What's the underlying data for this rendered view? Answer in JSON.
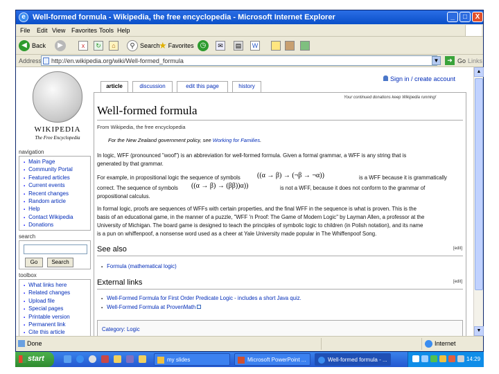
{
  "window": {
    "title": "Well-formed formula - Wikipedia, the free encyclopedia - Microsoft Internet Explorer",
    "controls": [
      "_",
      "□",
      "X"
    ]
  },
  "menu": [
    "File",
    "Edit",
    "View",
    "Favorites",
    "Tools",
    "Help"
  ],
  "toolbar": {
    "back": "Back",
    "search": "Search",
    "favorites": "Favorites"
  },
  "address": {
    "label": "Address",
    "url": "http://en.wikipedia.org/wiki/Well-formed_formula",
    "go": "Go",
    "links": "Links"
  },
  "wiki": {
    "logo_wordmark": "WIKIPEDIA",
    "logo_tagline": "The Free Encyclopedia",
    "tabs": [
      "article",
      "discussion",
      "edit this page",
      "history"
    ],
    "signin": "Sign in / create account",
    "navigation_title": "navigation",
    "navigation": [
      "Main Page",
      "Community Portal",
      "Featured articles",
      "Current events",
      "Recent changes",
      "Random article",
      "Help",
      "Contact Wikipedia",
      "Donations"
    ],
    "search_title": "search",
    "search_buttons": [
      "Go",
      "Search"
    ],
    "toolbox_title": "toolbox",
    "toolbox": [
      "What links here",
      "Related changes",
      "Upload file",
      "Special pages",
      "Printable version",
      "Permanent link",
      "Cite this article"
    ]
  },
  "article": {
    "notice": "Your continued donations keep Wikipedia running!",
    "title": "Well-formed formula",
    "from": "From Wikipedia, the free encyclopedia",
    "dablink_prefix": "For the New Zealand government policy, see ",
    "dablink_link": "Working for Families",
    "dablink_suffix": ".",
    "p1_line1": "In logic, WFF (pronounced \"woof\") is an abbreviation for well-formed formula. Given a formal grammar, a WFF is any string that is",
    "p1_line2": "generated by that grammar.",
    "p2_line1a": "For example, in propositional logic the sequence of symbols",
    "p2_formula1": "((α → β) → (¬β → ¬α))",
    "p2_line1b": "is a WFF because it is grammatically",
    "p2_line2a": "correct. The sequence of symbols",
    "p2_formula2": "((α → β) → (ββ))α))",
    "p2_line2b": "is not a WFF, because it does not conform to the grammar of",
    "p2_line3": "propositional calculus.",
    "p3_line1": "In formal logic, proofs are sequences of WFFs with certain properties, and the final WFF in the sequence is what is proven. This is the",
    "p3_line2": "basis of an educational game, in the manner of a puzzle, \"WFF 'n Proof: The Game of Modern Logic\" by Layman Allen, a professor at the",
    "p3_line3": "University of Michigan. The board game is designed to teach the principles of symbolic logic to children (in Polish notation), and its name",
    "p3_line4": "is a pun on whiffenpoof, a nonsense word used as a cheer at Yale University made popular in The Whiffenpoof Song.",
    "see_also": "See also",
    "see_also_items": [
      "Formula (mathematical logic)"
    ],
    "external_links": "External links",
    "external_items": [
      "Well-Formed Formula for First Order Predicate Logic - includes a short Java quiz.",
      "Well-Formed Formula at ProvenMath"
    ],
    "edit_label": "[edit]",
    "category": "Category: Logic"
  },
  "status": {
    "text": "Done",
    "zone": "Internet"
  },
  "taskbar": {
    "start": "start",
    "tasks": [
      "my slides",
      "Microsoft PowerPoint ...",
      "Well-formed formula - ..."
    ],
    "clock": "14:29"
  },
  "colors": {
    "link": "#002bb8",
    "titlebar": "#0a4fc8",
    "start_button": "#3a9a3a"
  }
}
